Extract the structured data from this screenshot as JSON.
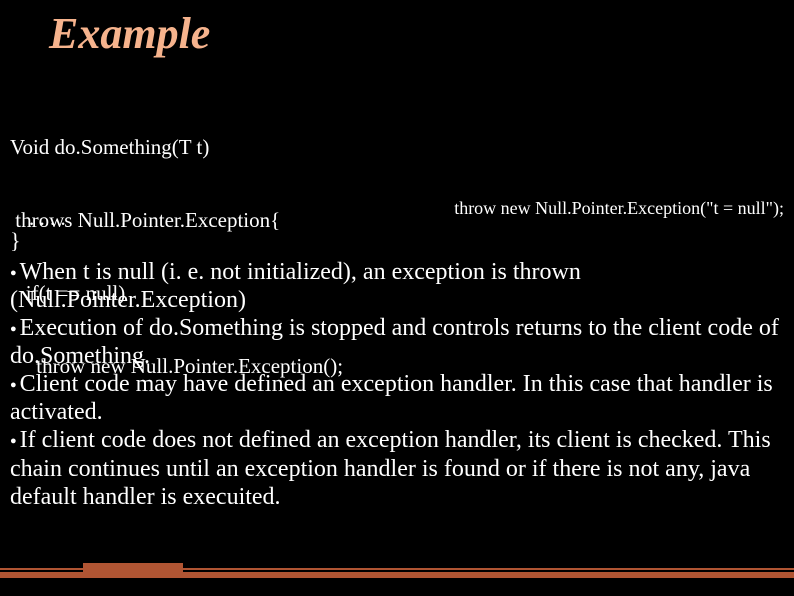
{
  "title": "Example",
  "code": {
    "l1": "Void do.Something(T t)",
    "l2": " throws Null.Pointer.Exception{",
    "l3": "   if(t == null)",
    "l4": "     throw new Null.Pointer.Exception();",
    "ellipsis": ". . . .",
    "close": "}"
  },
  "side_snippet": "throw new Null.Pointer.Exception(\"t = null\");",
  "bullets": {
    "b1": "When t is null (i. e. not initialized), an exception is thrown (Null.Pointer.Exception)",
    "b2": "Execution of do.Something is stopped and controls returns to the client code of do.Something.",
    "b3": "Client code may have defined an exception handler. In this case that handler is activated.",
    "b4": "If client code does not defined an exception handler, its client is checked. This chain continues until an exception handler is found or if there is not any, java default handler is execuited."
  }
}
